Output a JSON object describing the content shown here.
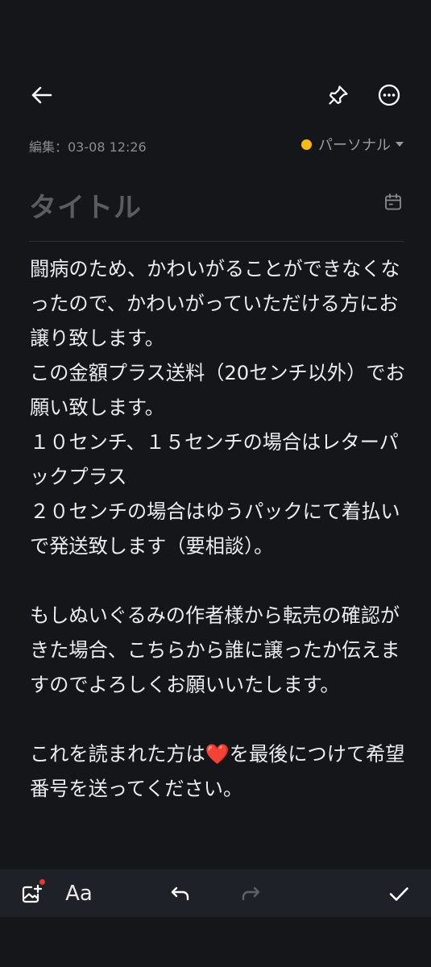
{
  "header": {
    "back_icon": "arrow-left-icon",
    "pin_icon": "pin-icon",
    "more_icon": "more-horizontal-icon"
  },
  "meta": {
    "edited_label": "編集：03-08 12:26",
    "category_label": "パーソナル",
    "category_color": "#f5b918"
  },
  "note": {
    "title_placeholder": "タイトル",
    "body": "闘病のため、かわいがることができなくなったので、かわいがっていただける方にお譲り致します。\nこの金額プラス送料（20センチ以外）でお願い致します。\n１０センチ、１５センチの場合はレターパックプラス\n２０センチの場合はゆうパックにて着払いで発送致します（要相談）。\n\nもしぬいぐるみの作者様から転売の確認がきた場合、こちらから誰に譲ったか伝えますのでよろしくお願いいたします。\n\nこれを読まれた方は❤️を最後につけて希望番号を送ってください。"
  },
  "toolbar": {
    "font_label": "Aa",
    "badge_color": "#e6383a"
  }
}
